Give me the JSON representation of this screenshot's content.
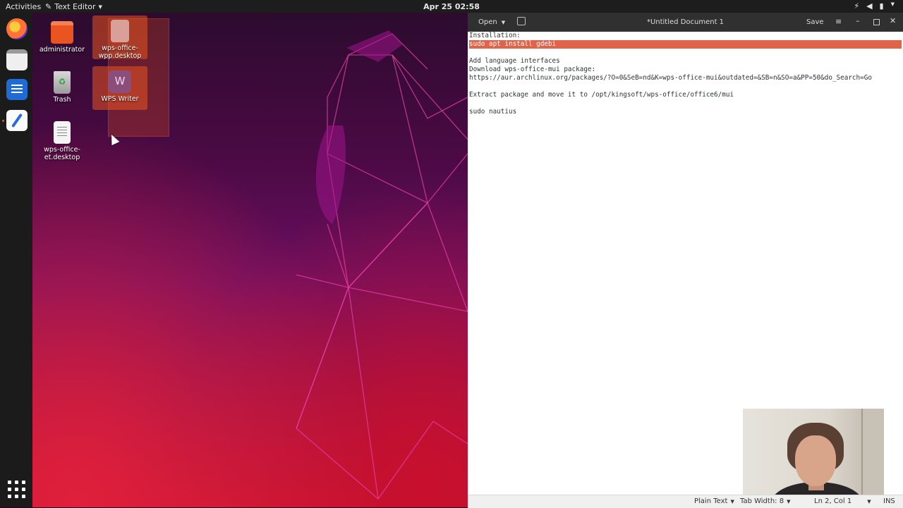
{
  "topbar": {
    "activities": "Activities",
    "app_name": "Text Editor",
    "clock": "Apr 25  02:58"
  },
  "dock": {
    "items": [
      "firefox-icon",
      "files-icon",
      "libreoffice-writer-icon",
      "text-editor-icon",
      "show-applications-icon"
    ]
  },
  "desktop": {
    "icons": [
      {
        "label": "administrator",
        "icon": "home-folder-icon"
      },
      {
        "label": "Trash",
        "icon": "trash-icon"
      },
      {
        "label": "wps-office-et.desktop",
        "icon": "document-icon"
      },
      {
        "label": "wps-office-wpp.desktop",
        "icon": "presentation-icon"
      },
      {
        "label": "WPS Writer",
        "icon": "wps-writer-icon"
      }
    ]
  },
  "editor": {
    "open_label": "Open",
    "title": "*Untitled Document 1",
    "save_label": "Save",
    "lines": [
      "Installation:",
      "sudo apt install gdebi",
      "",
      "Add language interfaces",
      "Download wps-office-mui package:",
      "https://aur.archlinux.org/packages/?O=0&SeB=nd&K=wps-office-mui&outdated=&SB=n&SO=a&PP=50&do_Search=Go",
      "",
      "Extract package and move it to /opt/kingsoft/wps-office/office6/mui",
      "",
      "sudo nautius"
    ],
    "highlighted_line": 1,
    "status": {
      "syntax": "Plain Text",
      "tab_width": "Tab Width: 8",
      "position": "Ln 2, Col 1",
      "mode": "INS"
    }
  },
  "colors": {
    "accent": "#e95420",
    "highlight": "#e0634a",
    "headerbar": "#303030"
  }
}
